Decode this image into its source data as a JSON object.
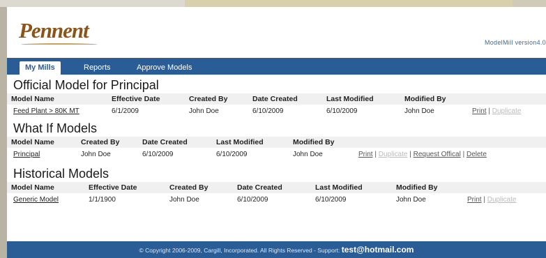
{
  "header": {
    "logo": "Pennent",
    "version": "ModelMill version4.0"
  },
  "nav": {
    "tabs": [
      "My Mills",
      "Reports",
      "Approve Models"
    ]
  },
  "official": {
    "title": "Official Model for Principal",
    "headers": [
      "Model Name",
      "Effective Date",
      "Created By",
      "Date Created",
      "Last Modified",
      "Modified By"
    ],
    "row": {
      "model_name": "Feed Plant > 80K MT",
      "effective_date": "6/1/2009",
      "created_by": "John Doe",
      "date_created": "6/10/2009",
      "last_modified": "6/10/2009",
      "modified_by": "John Doe",
      "print": "Print",
      "sep": "|",
      "duplicate": "Duplicate"
    }
  },
  "whatif": {
    "title": "What If Models",
    "headers": [
      "Model Name",
      "Created By",
      "Date Created",
      "Last Modified",
      "Modified By"
    ],
    "row": {
      "model_name": "Principal",
      "created_by": "John Doe",
      "date_created": "6/10/2009",
      "last_modified": "6/10/2009",
      "modified_by": "John Doe",
      "print": "Print",
      "sep": "|",
      "duplicate": "Duplicate",
      "request_official": "Request Offical",
      "delete": "Delete"
    }
  },
  "historical": {
    "title": "Historical Models",
    "headers": [
      "Model Name",
      "Effective Date",
      "Created By",
      "Date Created",
      "Last Modified",
      "Modified By"
    ],
    "row": {
      "model_name": "Generic Model",
      "effective_date": "1/1/1900",
      "created_by": "John Doe",
      "date_created": "6/10/2009",
      "last_modified": "6/10/2009",
      "modified_by": "John Doe",
      "print": "Print",
      "sep": "|",
      "duplicate": "Duplicate"
    }
  },
  "footer": {
    "text": "© Copyright 2006-2009, Cargill, Incorporated. All Rights Reserved - Support:",
    "email": "test@hotmail.com"
  }
}
